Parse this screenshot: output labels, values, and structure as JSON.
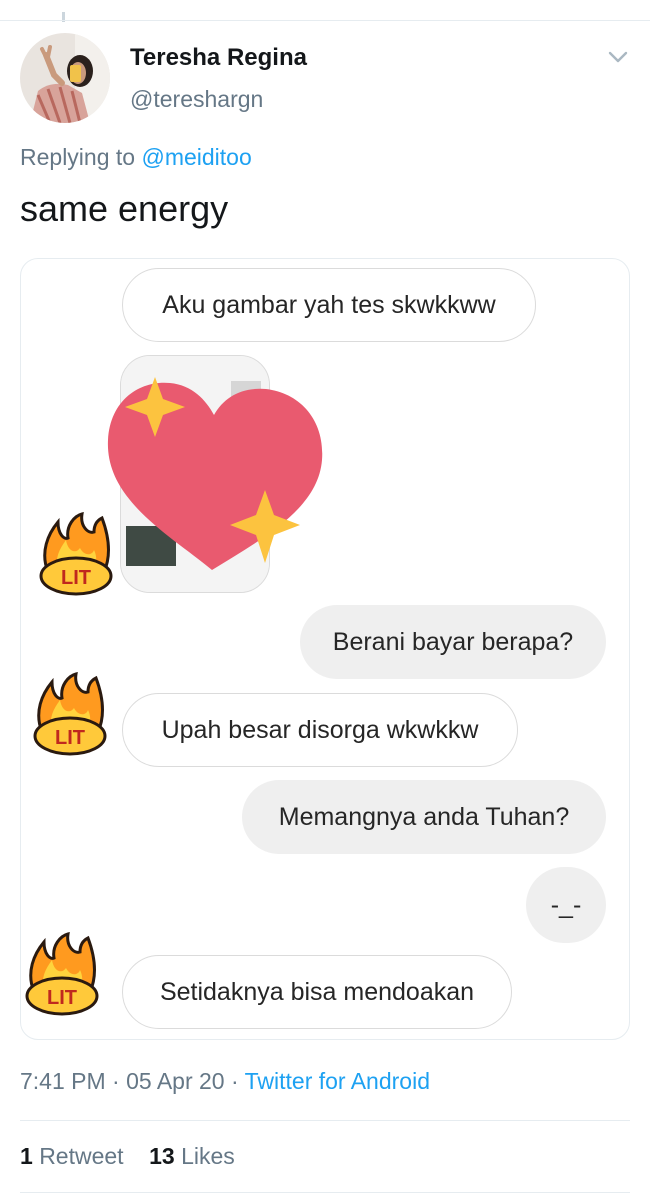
{
  "tweet": {
    "author_name": "Teresha Regina",
    "author_handle": "@tereshargn",
    "replying_prefix": "Replying to",
    "replying_to": "@meiditoo",
    "text": "same energy",
    "time": "7:41 PM",
    "separator": "·",
    "date": "05 Apr 20",
    "source": "Twitter for Android",
    "retweet_count": "1",
    "retweet_label": "Retweet",
    "like_count": "13",
    "like_label": "Likes"
  },
  "chat": {
    "messages": [
      {
        "side": "in",
        "text": "Aku gambar yah tes skwkkww"
      },
      {
        "side": "out",
        "text": "Berani bayar berapa?"
      },
      {
        "side": "in",
        "text": "Upah besar disorga wkwkkw"
      },
      {
        "side": "out",
        "text": "Memangnya anda Tuhan?"
      },
      {
        "side": "out",
        "text": "-_-"
      },
      {
        "side": "in",
        "text": "Setidaknya bisa mendoakan"
      }
    ],
    "sticker_text": "LIT"
  },
  "colors": {
    "link": "#1da1f2",
    "secondary_text": "#657786",
    "heart": "#e95a6f",
    "sparkle": "#fcc33f",
    "outgoing_bubble": "#efefef"
  },
  "icons": [
    "chevron-down-icon",
    "heart-sparkle-emoji",
    "lit-fire-sticker"
  ]
}
